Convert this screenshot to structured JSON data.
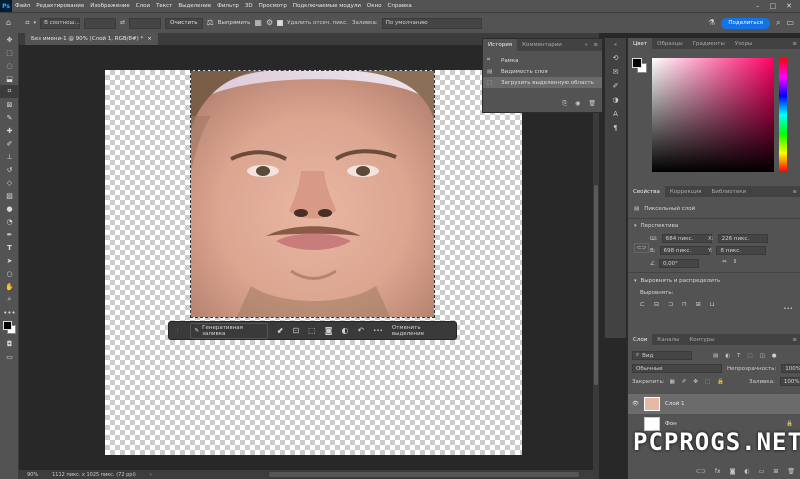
{
  "menu": {
    "logo": "Ps",
    "items": [
      "Файл",
      "Редактирование",
      "Изображение",
      "Слои",
      "Текст",
      "Выделение",
      "Фильтр",
      "3D",
      "Просмотр",
      "Подключаемые модули",
      "Окно",
      "Справка"
    ]
  },
  "options": {
    "mode_value": "В соотнош...",
    "clear_label": "Очистить",
    "straighten_label": "Выпрямить",
    "delete_pixels_label": "Удалить отсеч. пикс.",
    "fill_label": "Заливка:",
    "fill_value": "По умолчанию",
    "share_label": "Поделиться"
  },
  "document": {
    "tab_title": "Без имени-1 @ 90% (Слой 1, RGB/8#) *",
    "tab_close": "×"
  },
  "context_bar": {
    "generative_fill": "Генеративная заливка",
    "more": "•••",
    "deselect": "Отменить выделение"
  },
  "status": {
    "zoom": "90%",
    "size": "1112 пикс. x 1025 пикс. (72 ppi)"
  },
  "history": {
    "tabs": [
      "История",
      "Комментарии"
    ],
    "items": [
      "Рамка",
      "Видимость слоя",
      "Загрузить выделенную область"
    ],
    "selected_index": 2
  },
  "color_panel": {
    "tabs": [
      "Цвет",
      "Образцы",
      "Градиенты",
      "Узоры"
    ],
    "fg_color": "#000000",
    "bg_color": "#ffffff",
    "hue_color": "#ff0066"
  },
  "properties": {
    "tabs": [
      "Свойства",
      "Коррекция",
      "Библиотеки"
    ],
    "layer_type": "Пиксельный слой",
    "transform_title": "Перспектива",
    "w_label": "Ш:",
    "w_value": "684 пикс.",
    "h_label": "В:",
    "h_value": "698 пикс.",
    "x_label": "X:",
    "x_value": "226 пикс.",
    "y_label": "Y:",
    "y_value": "8 пикс.",
    "angle_value": "0,00°",
    "align_title": "Выровнять и распределить",
    "align_label": "Выровнять:"
  },
  "layers": {
    "tabs": [
      "Слои",
      "Каналы",
      "Контуры"
    ],
    "filter_label": "Вид",
    "blend_mode": "Обычные",
    "opacity_label": "Непрозрачность:",
    "opacity_value": "100%",
    "lock_label": "Закрепить:",
    "fill_label": "Заливка:",
    "fill_value": "100%",
    "items": [
      {
        "name": "Слой 1",
        "selected": true
      },
      {
        "name": "Фон",
        "selected": false
      }
    ]
  },
  "watermark": "PCPROGS.NET"
}
